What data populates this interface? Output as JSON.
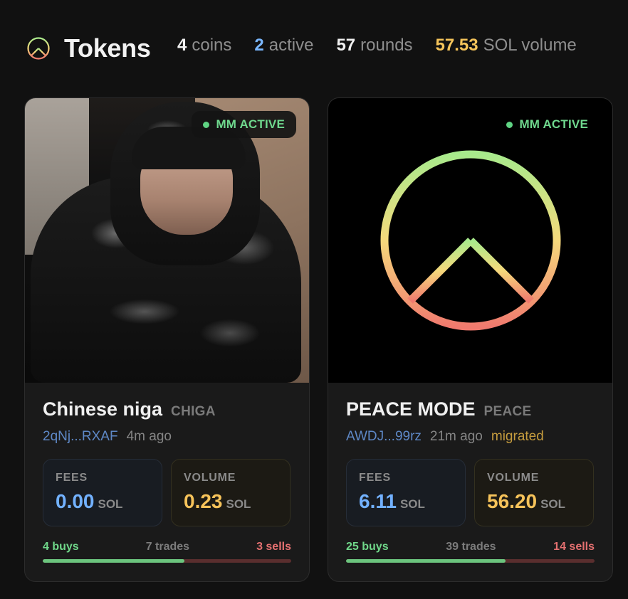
{
  "header": {
    "title": "Tokens",
    "logo_icon": "peace-icon",
    "stats": {
      "coins": {
        "value": "4",
        "label": "coins"
      },
      "active": {
        "value": "2",
        "label": "active"
      },
      "rounds": {
        "value": "57",
        "label": "rounds"
      },
      "volume": {
        "value": "57.53",
        "label": "SOL volume"
      }
    }
  },
  "cards": [
    {
      "name": "Chinese niga",
      "symbol": "CHIGA",
      "address": "2qNj...RXAF",
      "age": "4m ago",
      "migrated": "",
      "badge": "MM ACTIVE",
      "image": "photo-hooded-person",
      "fees": {
        "label": "FEES",
        "value": "0.00",
        "unit": "SOL"
      },
      "volume": {
        "label": "VOLUME",
        "value": "0.23",
        "unit": "SOL"
      },
      "buys": "4 buys",
      "trades": "7 trades",
      "sells": "3 sells",
      "buy_ratio": 0.5714
    },
    {
      "name": "PEACE MODE",
      "symbol": "PEACE",
      "address": "AWDJ...99rz",
      "age": "21m ago",
      "migrated": "migrated",
      "badge": "MM ACTIVE",
      "image": "peace-icon",
      "fees": {
        "label": "FEES",
        "value": "6.11",
        "unit": "SOL"
      },
      "volume": {
        "label": "VOLUME",
        "value": "56.20",
        "unit": "SOL"
      },
      "buys": "25 buys",
      "trades": "39 trades",
      "sells": "14 sells",
      "buy_ratio": 0.641
    }
  ],
  "colors": {
    "active_badge": "#6fd88e",
    "fees_accent": "#72b1ff",
    "volume_accent": "#f6c35a",
    "buys": "#70d88a",
    "sells": "#e47070",
    "peace_gradient_top": "#a8ea8c",
    "peace_gradient_bottom": "#f07a6e"
  }
}
